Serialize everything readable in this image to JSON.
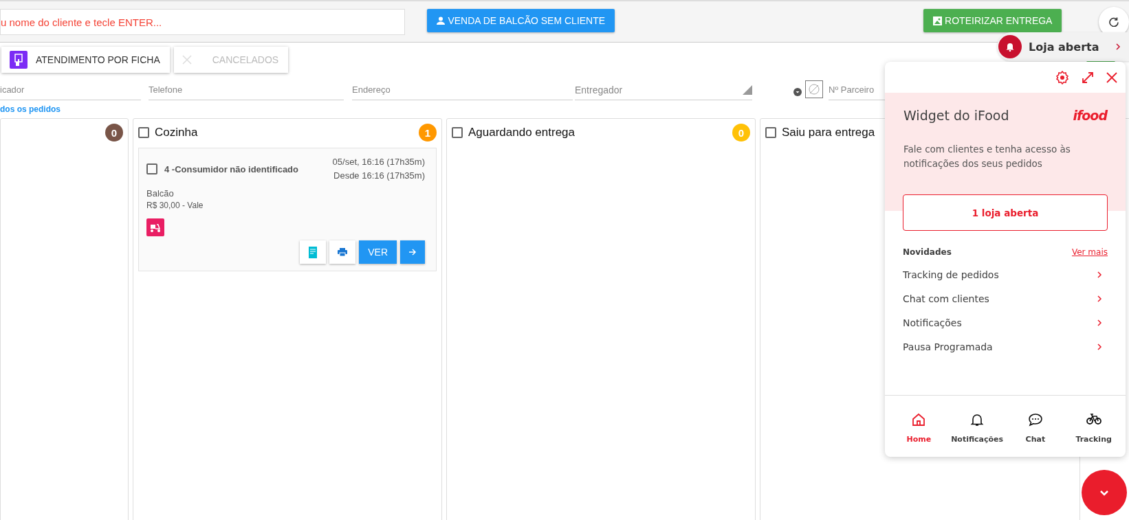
{
  "top_bar": {
    "search": {
      "placeholder": "u nome do cliente e tecle ENTER..."
    },
    "counter_sale_button": "VENDA DE BALCÃO SEM CLIENTE",
    "route_button": "ROTEIRIZAR ENTREGA"
  },
  "action_buttons": [
    {
      "label": "ATENDIMENTO POR FICHA",
      "disabled": false
    },
    {
      "label": "CANCELADOS",
      "disabled": true
    }
  ],
  "filters": [
    {
      "placeholder": "icador",
      "kind": "text"
    },
    {
      "placeholder": "Telefone",
      "kind": "text"
    },
    {
      "placeholder": "Endereço",
      "kind": "text"
    },
    {
      "placeholder": "Entregador",
      "kind": "select"
    },
    {
      "placeholder": "Nº Parceiro",
      "kind": "partner"
    }
  ],
  "all_orders_link": "dos os pedidos",
  "columns": [
    {
      "count": "0",
      "color": "#795548"
    },
    {
      "title": "Cozinha",
      "checked": false,
      "count": "1",
      "color": "#ff9800",
      "orders": [
        {
          "title": "4 -Consumidor não identificado",
          "checked": false,
          "date": "05/set, 16:16 (17h35m)",
          "since": "Desde 16:16 (17h35m)",
          "type": "Balcão",
          "payment": "R$ 30,00 - Vale",
          "view_button": "VER"
        }
      ]
    },
    {
      "title": "Aguardando entrega",
      "checked": false,
      "count": "0",
      "color": "#ffc107"
    },
    {
      "title": "Saiu para entrega",
      "checked": false
    }
  ],
  "store_status": {
    "label": "Loja aberta"
  },
  "widget": {
    "title": "Widget do iFood",
    "logo": "ifood",
    "description": "Fale com clientes e tenha acesso às notificações dos seus pedidos",
    "stores_button": "1 loja aberta",
    "news_heading": "Novidades",
    "see_more": "Ver mais",
    "news": [
      "Tracking de pedidos",
      "Chat com clientes",
      "Notificações",
      "Pausa Programada"
    ],
    "nav": [
      {
        "label": "Home",
        "kind": "home",
        "selected": true
      },
      {
        "label": "Notificações",
        "kind": "notifications",
        "selected": false
      },
      {
        "label": "Chat",
        "kind": "chat",
        "selected": false
      },
      {
        "label": "Tracking",
        "kind": "tracking",
        "selected": false
      }
    ]
  }
}
